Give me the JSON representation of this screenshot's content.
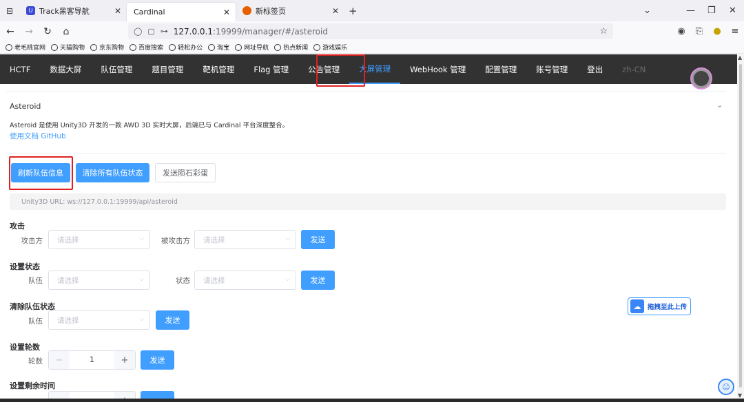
{
  "browser": {
    "tabs": [
      {
        "label": "Track黑客导航",
        "favicon": "U"
      },
      {
        "label": "Cardinal"
      },
      {
        "label": "新标签页"
      }
    ],
    "url_host": "127.0.0.1",
    "url_path": ":19999/manager/#/asteroid",
    "bookmarks": [
      "老毛桃官网",
      "天猫购物",
      "京东购物",
      "百度搜索",
      "轻松办公",
      "淘宝",
      "网址导航",
      "热点新闻",
      "游戏娱乐"
    ]
  },
  "appnav": {
    "items": [
      "HCTF",
      "数据大屏",
      "队伍管理",
      "题目管理",
      "靶机管理",
      "Flag 管理",
      "公告管理",
      "大屏管理",
      "WebHook 管理",
      "配置管理",
      "账号管理",
      "登出",
      "zh-CN"
    ]
  },
  "asteroid": {
    "title": "Asteroid",
    "description": "Asteroid 是使用 Unity3D 开发的一款 AWD 3D 实时大屏，后端已与 Cardinal 平台深度整合。",
    "links": "使用文档 GitHub",
    "btn_refresh": "刷新队伍信息",
    "btn_clear_all": "清除所有队伍状态",
    "btn_easter_egg": "发送陨石彩蛋",
    "unity_url": "Unity3D URL: ws://127.0.0.1:19999/api/asteroid"
  },
  "attack": {
    "title": "攻击",
    "attacker_label": "攻击方",
    "victim_label": "被攻击方",
    "placeholder": "请选择",
    "send": "发送"
  },
  "set_status": {
    "title": "设置状态",
    "team_label": "队伍",
    "status_label": "状态",
    "placeholder": "请选择",
    "send": "发送"
  },
  "clear_status": {
    "title": "清除队伍状态",
    "team_label": "队伍",
    "placeholder": "请选择",
    "send": "发送"
  },
  "set_round": {
    "title": "设置轮数",
    "round_label": "轮数",
    "value": "1",
    "send": "发送"
  },
  "set_time": {
    "title": "设置剩余时间"
  },
  "upload": {
    "label": "拖拽至此上传"
  },
  "colors": {
    "primary": "#409eff",
    "nav_bg": "#323232",
    "highlight": "#e02020"
  }
}
